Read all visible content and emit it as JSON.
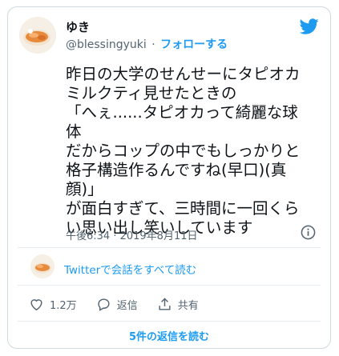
{
  "user": {
    "name": "ゆき",
    "handle": "@blessingyuki",
    "separator": "·",
    "follow_label": "フォローする"
  },
  "tweet": {
    "text": "昨日の大学のせんせーにタピオカ\nミルクティ見せたときの\n「へぇ......タピオカって綺麗な球体\nだからコップの中でもしっかりと\n格子構造作るんですね(早口)(真\n顔)」\nが面白すぎて、三時間に一回くら\nい思い出し笑いしています",
    "timestamp": "午後6:34 · 2019年8月11日"
  },
  "conversation": {
    "link_label": "Twitterで会話をすべて読む"
  },
  "actions": {
    "like_count": "1.2万",
    "reply_label": "返信",
    "share_label": "共有"
  },
  "replies_button": "5件の返信を読む",
  "colors": {
    "accent": "#1d9bf0",
    "text": "#0f1419",
    "muted": "#536471",
    "border": "#cfd9de"
  },
  "icons": [
    "twitter-bird-icon",
    "info-icon",
    "heart-icon",
    "reply-bubble-icon",
    "share-icon"
  ]
}
